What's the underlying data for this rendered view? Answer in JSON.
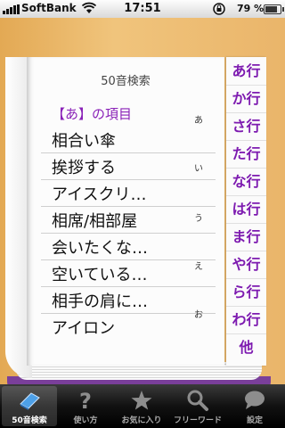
{
  "status_bar": {
    "carrier": "SoftBank",
    "time": "17:51",
    "battery_percent": "79 %",
    "battery_level": 0.79
  },
  "page": {
    "title": "50音検索",
    "section_header": "【あ】の項目",
    "words": [
      "相合い傘",
      "挨拶する",
      "アイスクリ…",
      "相席/相部屋",
      "会いたくな…",
      "空いている…",
      "相手の肩に…",
      "アイロン"
    ],
    "kana_marks": [
      "あ",
      "い",
      "う",
      "え",
      "お"
    ]
  },
  "index": [
    "あ行",
    "か行",
    "さ行",
    "た行",
    "な行",
    "は行",
    "ま行",
    "や行",
    "ら行",
    "わ行",
    "他"
  ],
  "tabbar": {
    "tabs": [
      {
        "label": "50音検索",
        "icon": "book-icon",
        "active": true
      },
      {
        "label": "使い方",
        "icon": "question-icon",
        "active": false
      },
      {
        "label": "お気に入り",
        "icon": "star-icon",
        "active": false
      },
      {
        "label": "フリーワード",
        "icon": "magnifier-icon",
        "active": false
      },
      {
        "label": "設定",
        "icon": "speech-bubble-icon",
        "active": false
      }
    ]
  },
  "colors": {
    "accent": "#7d1ab0",
    "background": "#e9b66b"
  }
}
